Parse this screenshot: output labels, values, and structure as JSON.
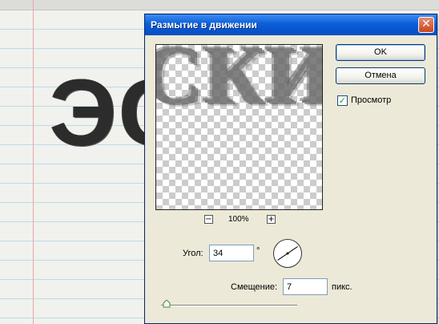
{
  "canvas": {
    "text": "ЭС"
  },
  "dialog": {
    "title": "Размытие в движении",
    "close_glyph": "✕",
    "preview_text": "СКИ",
    "zoom": {
      "out_glyph": "−",
      "value": "100%",
      "in_glyph": "+"
    },
    "buttons": {
      "ok": "OK",
      "cancel": "Отмена"
    },
    "preview_option": {
      "label": "Просмотр",
      "checked": true,
      "check_glyph": "✓"
    },
    "angle": {
      "label": "Угол:",
      "value": "34",
      "unit": "°"
    },
    "distance": {
      "label": "Смещение:",
      "value": "7",
      "unit": "пикс."
    },
    "slider": {
      "level": 0.04
    }
  },
  "icons": [
    "close-icon",
    "zoom-out-icon",
    "zoom-in-icon",
    "checkmark-icon",
    "angle-dial-icon",
    "slider-thumb-icon"
  ],
  "colors": {
    "title_bar": "#0a5fd8",
    "dialog_bg": "#ece9d8",
    "close_button": "#c9451f",
    "paper_line": "#b9dde6",
    "margin_line": "#e6a7a7"
  }
}
